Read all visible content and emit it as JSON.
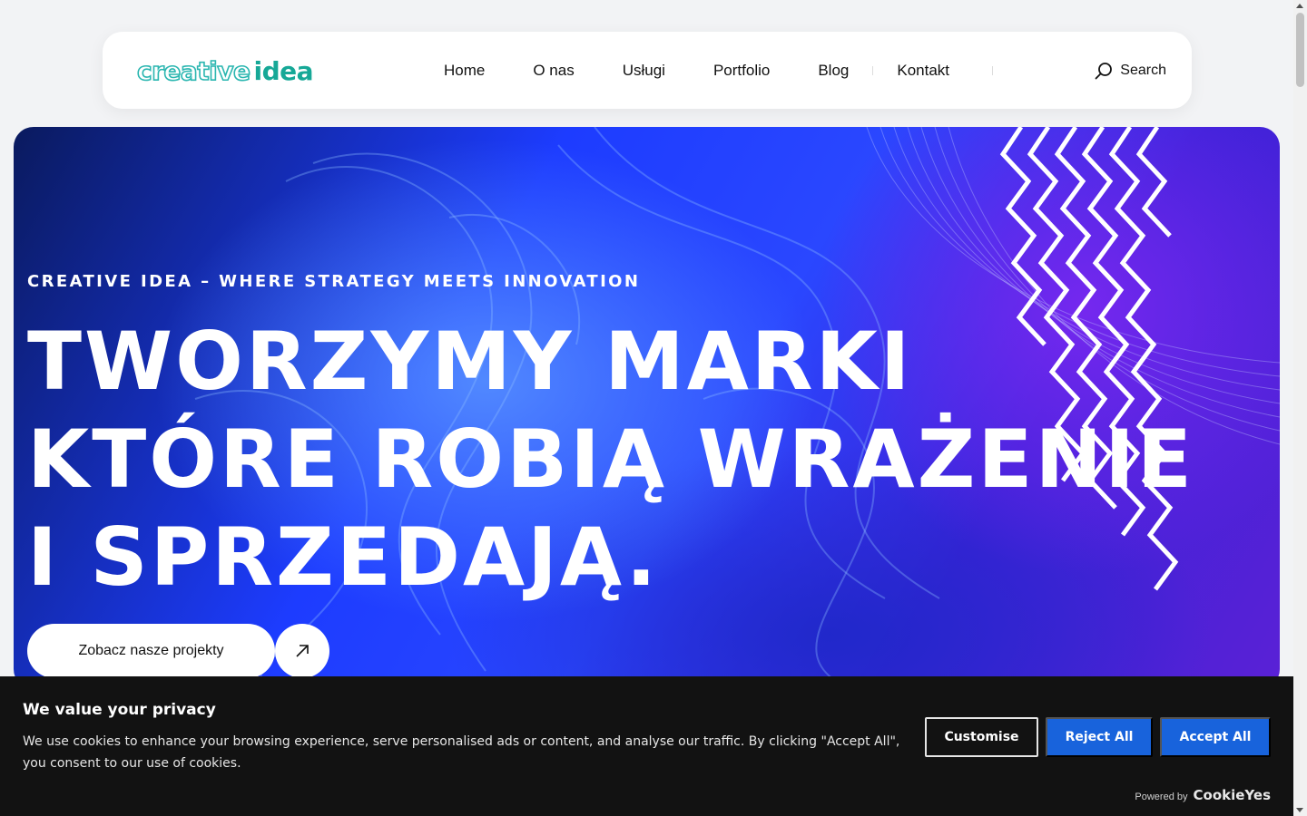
{
  "header": {
    "logo_part1": "creative",
    "logo_part2": "idea",
    "nav": [
      "Home",
      "O nas",
      "Usługi",
      "Portfolio",
      "Blog",
      "Kontakt"
    ],
    "search_label": "Search"
  },
  "hero": {
    "eyebrow": "CREATIVE IDEA – WHERE STRATEGY MEETS INNOVATION",
    "headline_line1": "TWORZYMY  MARKI",
    "headline_line2": "KTÓRE ROBIĄ WRAŻENIE",
    "headline_line3": "I SPRZEDAJĄ.",
    "cta_label": "Zobacz nasze projekty"
  },
  "cookie": {
    "title": "We value your privacy",
    "text": "We use cookies to enhance your browsing experience, serve personalised ads or content, and analyse our traffic. By clicking \"Accept All\", you consent to our use of cookies.",
    "customise_label": "Customise",
    "reject_label": "Reject All",
    "accept_label": "Accept All",
    "powered_by": "Powered by",
    "powered_brand": "CookieYes"
  },
  "colors": {
    "accent_blue": "#1863dc",
    "logo_teal": "#16a897",
    "hero_blue": "#1d3cff",
    "hero_purple": "#5a21d6"
  }
}
